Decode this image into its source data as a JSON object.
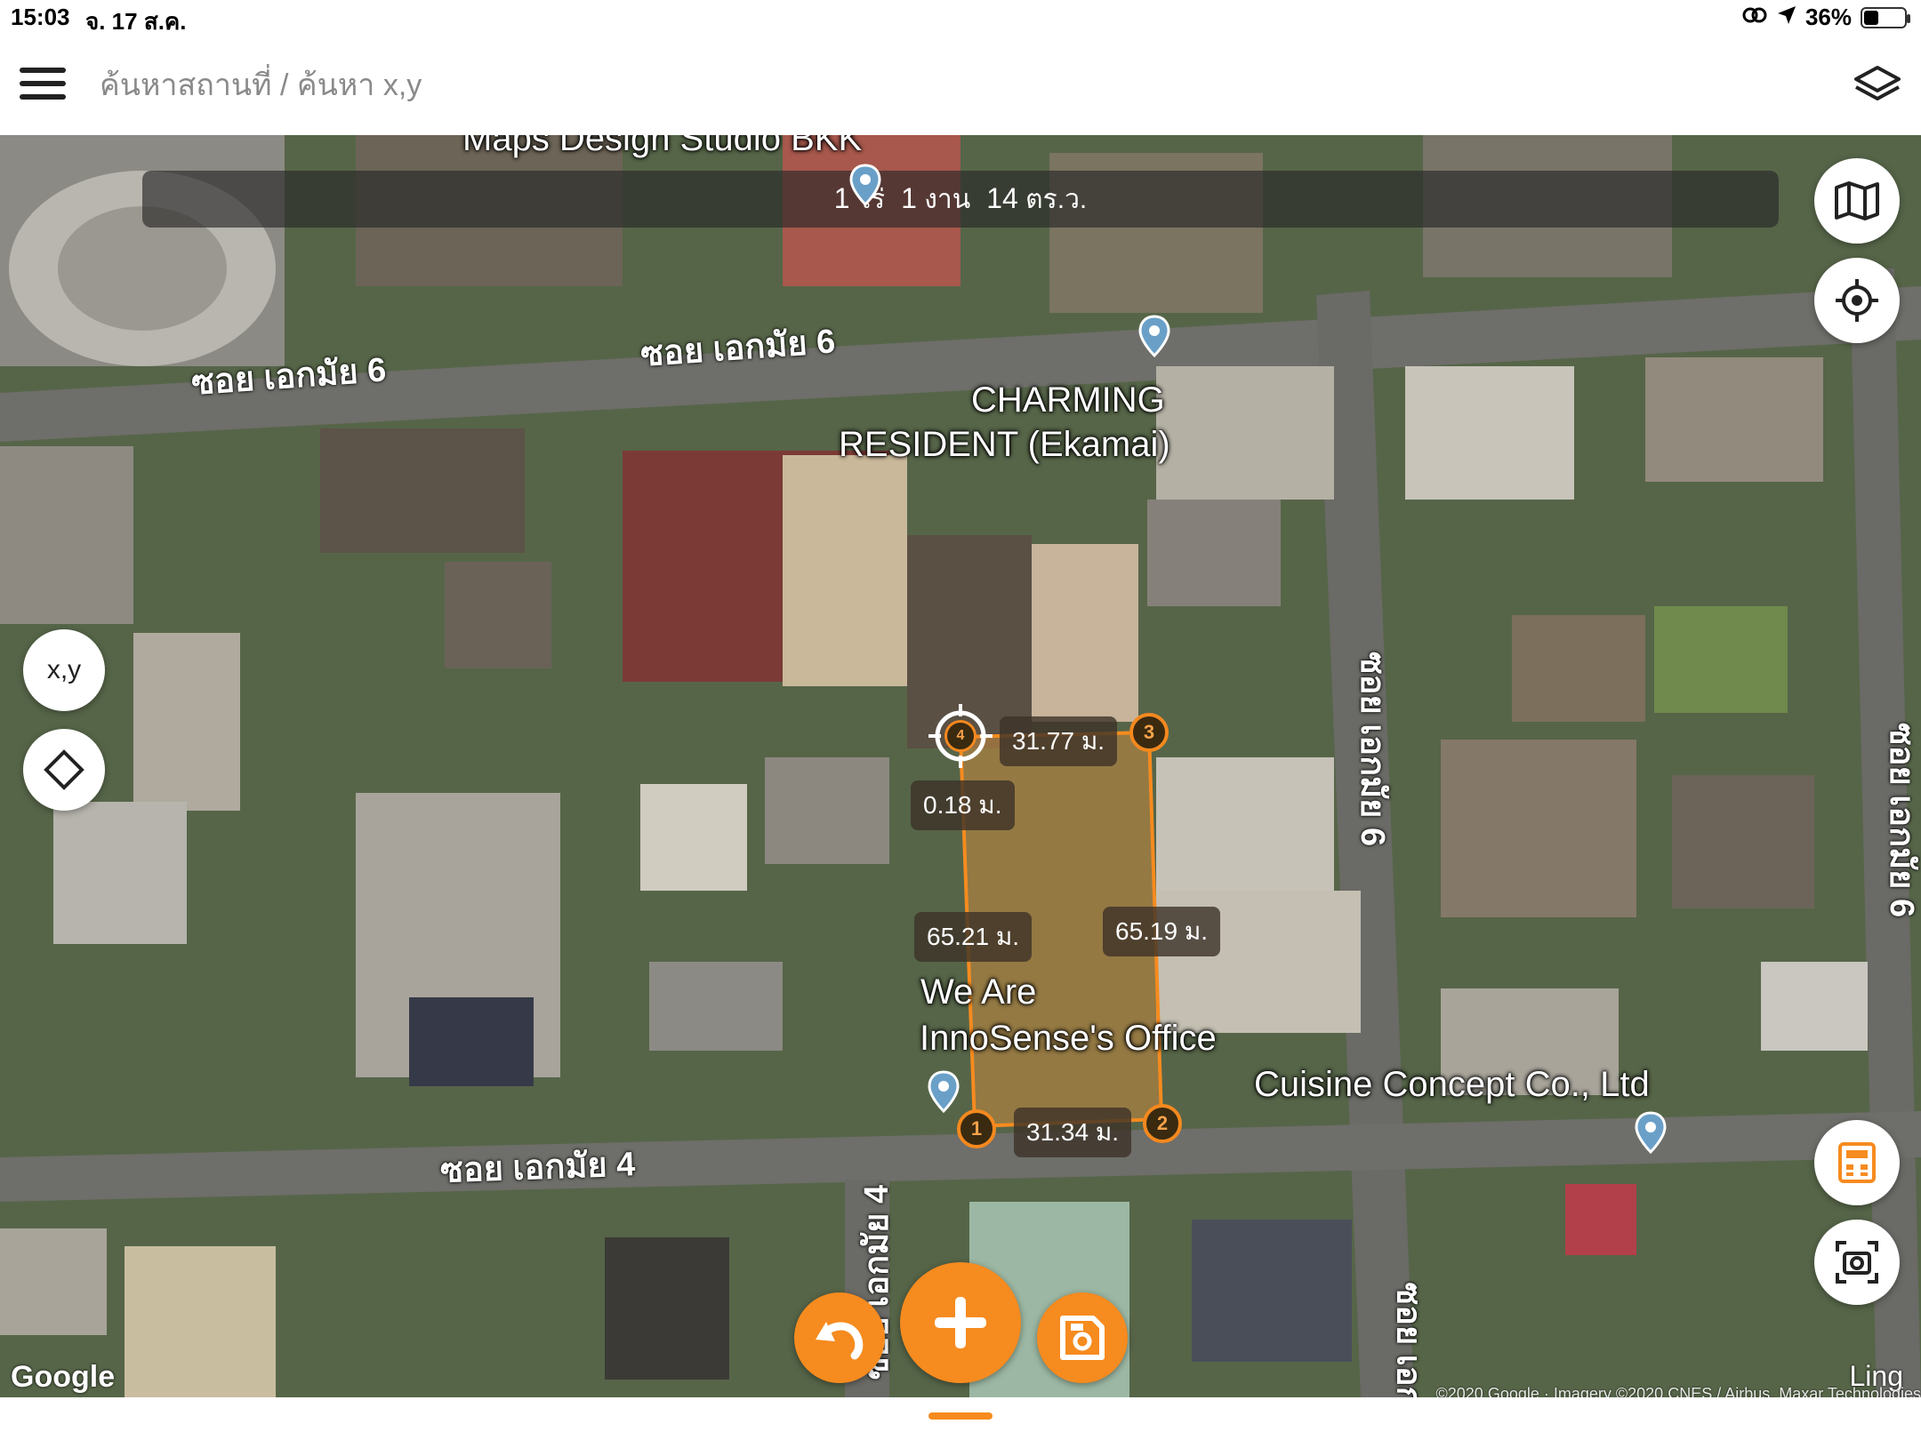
{
  "status_bar": {
    "time": "15:03",
    "date": "จ. 17 ส.ค.",
    "battery": "36%",
    "battery_level": 0.36
  },
  "header": {
    "search_text": "ค้นหาสถานที่ / ค้นหา x,y"
  },
  "area": {
    "rai_value": "1",
    "rai_unit": "ไร่",
    "ngan_value": "1",
    "ngan_unit": "งาน",
    "wa_value": "14",
    "wa_unit": "ตร.ว."
  },
  "map": {
    "roads": {
      "ekkamai6_left": "ซอย เอกมัย 6",
      "ekkamai6_right": "ซอย เอกมัย 6",
      "ekkamai6_vertical": "ซอย เอกมัย 6",
      "ekkamai6_far_right": "ซอย เอกมัย 6",
      "ekkamai4": "ซอย เอกมัย 4",
      "ekkamai4_vertical": "ซอย เอกมัย 4",
      "bottom_vertical": "ซอย เอก"
    },
    "pois": {
      "top_cut": "Maps Design Studio BKK",
      "charming_line1": "CHARMING",
      "charming_line2": "RESIDENT (Ekamai)",
      "innosense_line1": "We Are",
      "innosense_line2": "InnoSense's Office",
      "cuisine": "Cuisine Concept Co., Ltd"
    },
    "distances": {
      "top": "31.77 ม.",
      "small": "0.18 ม.",
      "left": "65.21 ม.",
      "right": "65.19 ม.",
      "bottom": "31.34 ม."
    },
    "vertices": [
      "1",
      "2",
      "3",
      "4"
    ],
    "google": "Google",
    "ling": "Ling",
    "copyright": "©2020 Google · Imagery ©2020 CNES / Airbus, Maxar Technologies"
  },
  "controls": {
    "xy_label": "x,y",
    "accent": "#f68b1f"
  }
}
